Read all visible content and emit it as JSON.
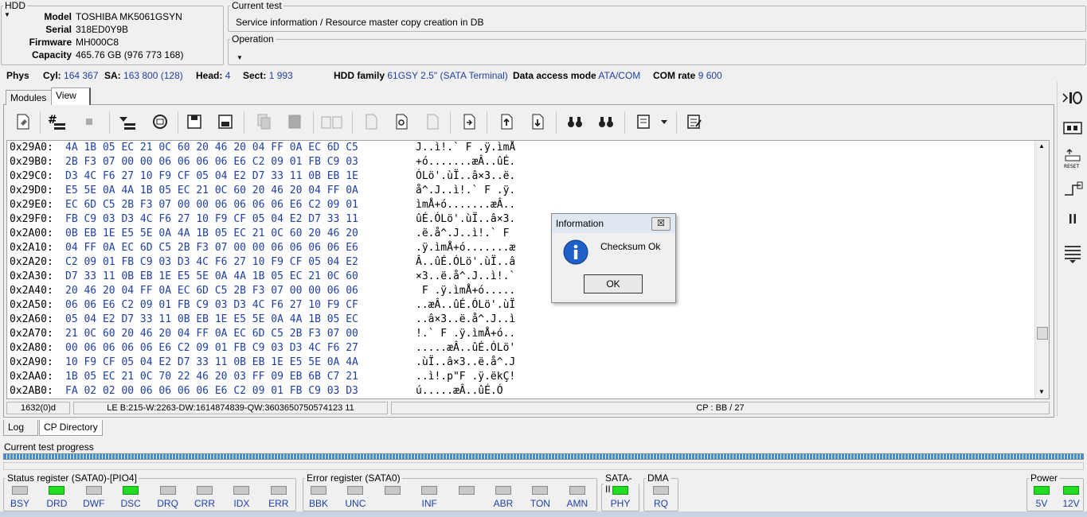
{
  "hdd": {
    "legend": "HDD",
    "model_label": "Model",
    "model": "TOSHIBA MK5061GSYN",
    "serial_label": "Serial",
    "serial": "318ED0Y9B",
    "firmware_label": "Firmware",
    "firmware": "MH000C8",
    "capacity_label": "Capacity",
    "capacity": "465.76 GB (976 773 168)"
  },
  "current_test": {
    "legend": "Current test",
    "value": "Service information / Resource master copy creation in DB"
  },
  "operation": {
    "legend": "Operation",
    "value": ""
  },
  "status": {
    "phys": "Phys",
    "cyl_label": "Cyl:",
    "cyl": "164 367",
    "sa_label": "SA:",
    "sa": "163 800 (128)",
    "head_label": "Head:",
    "head": "4",
    "sect_label": "Sect:",
    "sect": "1 993",
    "family_label": "HDD family",
    "family": "61GSY 2.5\" (SATA Terminal)",
    "access_label": "Data access mode",
    "access": "ATA/COM",
    "com_label": "COM rate",
    "com": "9 600"
  },
  "tabs": {
    "modules": "Modules",
    "view": "View"
  },
  "hex_rows": [
    {
      "addr": "0x29A0:",
      "bytes": "4A 1B 05 EC 21 0C 60 20 46 20 04 FF 0A EC 6D C5",
      "ascii": "J..ì!.` F .ÿ.ìmÅ"
    },
    {
      "addr": "0x29B0:",
      "bytes": "2B F3 07 00 00 06 06 06 06 E6 C2 09 01 FB C9 03",
      "ascii": "+ó.......æÂ..ûÉ."
    },
    {
      "addr": "0x29C0:",
      "bytes": "D3 4C F6 27 10 F9 CF 05 04 E2 D7 33 11 0B EB 1E",
      "ascii": "ÓLö'.ùÏ..â×3..ë."
    },
    {
      "addr": "0x29D0:",
      "bytes": "E5 5E 0A 4A 1B 05 EC 21 0C 60 20 46 20 04 FF 0A",
      "ascii": "å^.J..ì!.` F .ÿ."
    },
    {
      "addr": "0x29E0:",
      "bytes": "EC 6D C5 2B F3 07 00 00 06 06 06 06 E6 C2 09 01",
      "ascii": "ìmÅ+ó.......æÂ.."
    },
    {
      "addr": "0x29F0:",
      "bytes": "FB C9 03 D3 4C F6 27 10 F9 CF 05 04 E2 D7 33 11",
      "ascii": "ûÉ.ÓLö'.ùÏ..â×3."
    },
    {
      "addr": "0x2A00:",
      "bytes": "0B EB 1E E5 5E 0A 4A 1B 05 EC 21 0C 60 20 46 20",
      "ascii": ".ë.å^.J..ì!.` F "
    },
    {
      "addr": "0x2A10:",
      "bytes": "04 FF 0A EC 6D C5 2B F3 07 00 00 06 06 06 06 E6",
      "ascii": ".ÿ.ìmÅ+ó.......æ"
    },
    {
      "addr": "0x2A20:",
      "bytes": "C2 09 01 FB C9 03 D3 4C F6 27 10 F9 CF 05 04 E2",
      "ascii": "Â..ûÉ.ÓLö'.ùÏ..â"
    },
    {
      "addr": "0x2A30:",
      "bytes": "D7 33 11 0B EB 1E E5 5E 0A 4A 1B 05 EC 21 0C 60",
      "ascii": "×3..ë.å^.J..ì!.`"
    },
    {
      "addr": "0x2A40:",
      "bytes": "20 46 20 04 FF 0A EC 6D C5 2B F3 07 00 00 06 06",
      "ascii": " F .ÿ.ìmÅ+ó....."
    },
    {
      "addr": "0x2A50:",
      "bytes": "06 06 E6 C2 09 01 FB C9 03 D3 4C F6 27 10 F9 CF",
      "ascii": "..æÂ..ûÉ.ÓLö'.ùÏ"
    },
    {
      "addr": "0x2A60:",
      "bytes": "05 04 E2 D7 33 11 0B EB 1E E5 5E 0A 4A 1B 05 EC",
      "ascii": "..â×3..ë.å^.J..ì"
    },
    {
      "addr": "0x2A70:",
      "bytes": "21 0C 60 20 46 20 04 FF 0A EC 6D C5 2B F3 07 00",
      "ascii": "!.` F .ÿ.ìmÅ+ó.."
    },
    {
      "addr": "0x2A80:",
      "bytes": "00 06 06 06 06 E6 C2 09 01 FB C9 03 D3 4C F6 27",
      "ascii": ".....æÂ..ûÉ.ÓLö'"
    },
    {
      "addr": "0x2A90:",
      "bytes": "10 F9 CF 05 04 E2 D7 33 11 0B EB 1E E5 5E 0A 4A",
      "ascii": ".ùÏ..â×3..ë.å^.J"
    },
    {
      "addr": "0x2AA0:",
      "bytes": "1B 05 EC 21 0C 70 22 46 20 03 FF 09 EB 6B C7 21",
      "ascii": "..ì!.p\"F .ÿ.ëkÇ!"
    },
    {
      "addr": "0x2AB0:",
      "bytes": "FA 02 02 00 06 06 06 06 E6 C2 09 01 FB C9 03 D3",
      "ascii": "ú.....æÂ..ûÉ.Ó"
    }
  ],
  "dialog": {
    "title": "Information",
    "close": "☒",
    "message": "Checksum Ok",
    "ok": "OK"
  },
  "statusbar": {
    "pos": "1632(0)d",
    "info": "LE B:215-W:2263-DW:1614874839-QW:3603650750574123 11",
    "cp": "CP : BB / 27"
  },
  "bottom_tabs": {
    "log": "Log",
    "cp": "CP Directory"
  },
  "progress": {
    "label": "Current test progress",
    "fraction": 1.0,
    "color": "#3a8de0"
  },
  "status_register": {
    "legend": "Status register (SATA0)-[PIO4]",
    "leds": [
      {
        "label": "BSY",
        "on": false
      },
      {
        "label": "DRD",
        "on": true
      },
      {
        "label": "DWF",
        "on": false
      },
      {
        "label": "DSC",
        "on": true
      },
      {
        "label": "DRQ",
        "on": false
      },
      {
        "label": "CRR",
        "on": false
      },
      {
        "label": "IDX",
        "on": false
      },
      {
        "label": "ERR",
        "on": false
      }
    ]
  },
  "error_register": {
    "legend": "Error register (SATA0)",
    "leds": [
      {
        "label": "BBK",
        "on": false
      },
      {
        "label": "UNC",
        "on": false
      },
      {
        "label": "",
        "on": false
      },
      {
        "label": "INF",
        "on": false
      },
      {
        "label": "",
        "on": false
      },
      {
        "label": "ABR",
        "on": false
      },
      {
        "label": "TON",
        "on": false
      },
      {
        "label": "AMN",
        "on": false
      }
    ]
  },
  "sata": {
    "legend": "SATA-II",
    "label": "PHY",
    "on": true
  },
  "dma": {
    "legend": "DMA",
    "label": "RQ",
    "on": false
  },
  "power": {
    "legend": "Power",
    "v5": "5V",
    "v12": "12V",
    "v5_on": true,
    "v12_on": true
  },
  "colors": {
    "accent_blue": "#1f3fa8",
    "led_on": "#22dd22",
    "led_off": "#c8c8c8"
  }
}
